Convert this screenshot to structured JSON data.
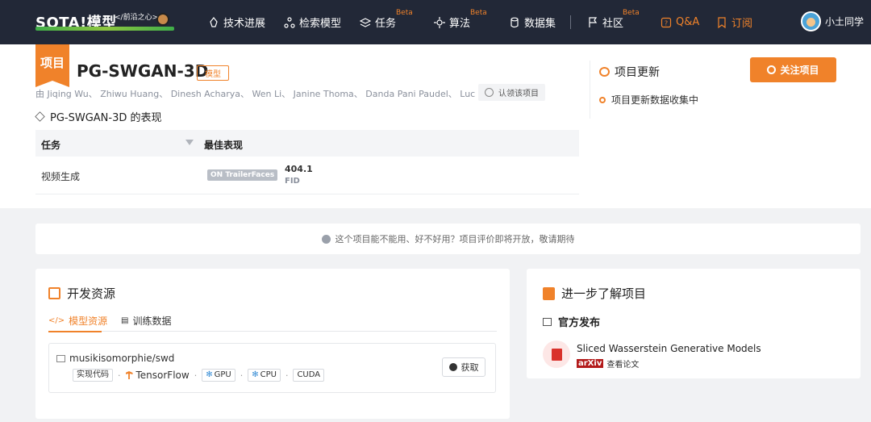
{
  "nav": {
    "logo": "SOTA!模型",
    "logo_sub": "</前沿之心>",
    "items": [
      {
        "label": "技术进展"
      },
      {
        "label": "检索模型"
      },
      {
        "label": "任务",
        "badge": "Beta"
      },
      {
        "label": "算法",
        "badge": "Beta"
      },
      {
        "label": "数据集"
      },
      {
        "label": "社区",
        "badge": "Beta"
      },
      {
        "label": "Q&A"
      },
      {
        "label": "订阅"
      }
    ],
    "user": "小土同学"
  },
  "project": {
    "tag": "项目",
    "title": "PG-SWGAN-3D",
    "type": "模型",
    "authors": "由 Jiqing Wu、 Zhiwu Huang、 Dinesh Acharya、 Wen Li、 Janine Thoma、 Danda Pani Paudel、 Luc van Gool 研发",
    "claim": "认领该项目"
  },
  "performance": {
    "title": "PG-SWGAN-3D 的表现",
    "col_task": "任务",
    "col_best": "最佳表现",
    "rows": [
      {
        "task": "视频生成",
        "dataset": "ON TrailerFaces",
        "value": "404.1",
        "metric": "FID"
      }
    ]
  },
  "updates": {
    "title": "项目更新",
    "item": "项目更新数据收集中",
    "follow": "关注项目"
  },
  "notice": "这个项目能不能用、好不好用？项目评价即将开放，敬请期待",
  "dev": {
    "title": "开发资源",
    "tab_model": "模型资源",
    "tab_data": "训练数据",
    "repo": {
      "name": "musikisomorphie/swd",
      "tag_code": "实现代码",
      "framework": "TensorFlow",
      "chips": [
        "GPU",
        "CPU"
      ],
      "cuda": "CUDA",
      "get": "获取"
    }
  },
  "learn": {
    "title": "进一步了解项目",
    "official": "官方发布",
    "paper_title": "Sliced Wasserstein Generative Models",
    "arxiv": "arXiv",
    "view": "查看论文"
  },
  "colors": {
    "accent": "#f0822a",
    "nav_bg": "#222837"
  }
}
